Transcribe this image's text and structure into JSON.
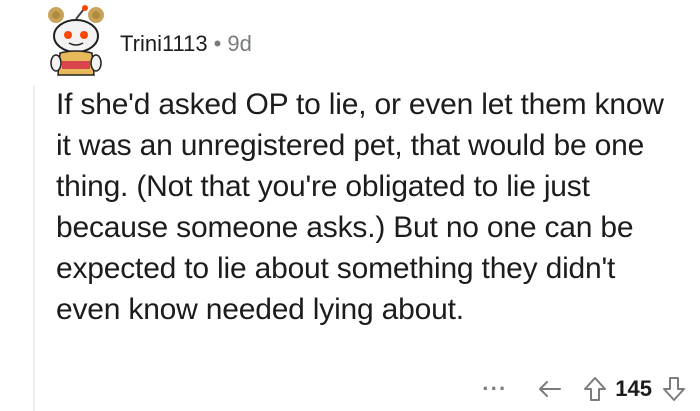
{
  "comment": {
    "username": "Trini1113",
    "separator": "•",
    "age": "9d",
    "body": "If she'd asked OP to lie, or even let them know it was an unregistered pet, that would be one thing. (Not that you're obligated to lie just because someone asks.) But no one can be expected to lie about something they didn't even know needed lying about.",
    "actions": {
      "more": "···",
      "score": "145"
    }
  },
  "icons": {
    "avatar": "snoo-avatar-icon",
    "reply": "reply-arrow-icon",
    "upvote": "upvote-arrow-icon",
    "downvote": "downvote-arrow-icon"
  },
  "colors": {
    "text": "#1c1c1c",
    "meta": "#787c7e",
    "avatar_orange": "#ff4500",
    "thread_line": "#ededed"
  }
}
